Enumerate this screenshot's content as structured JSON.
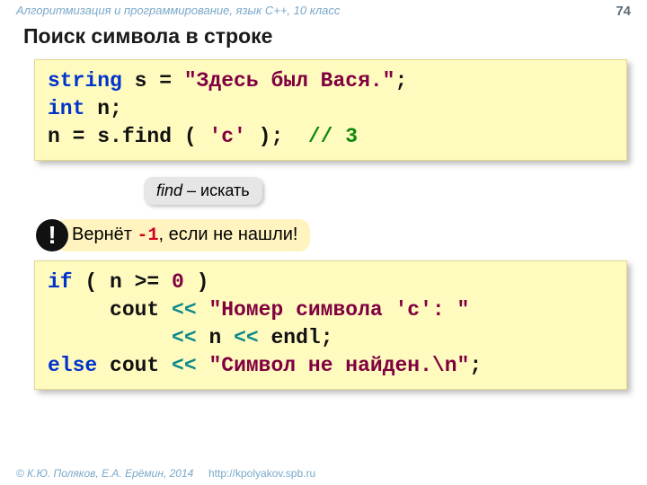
{
  "header": {
    "course": "Алгоритмизация и программирование, язык C++, 10 класс",
    "page": "74"
  },
  "title": "Поиск символа в строке",
  "code1": {
    "l1a": "string",
    "l1b": " s = ",
    "l1c": "\"Здесь был Вася.\"",
    "l1d": ";",
    "l2a": "int",
    "l2b": " n;",
    "l3a": "n = s.find ( ",
    "l3b": "'с'",
    "l3c": " );  ",
    "l3d": "// 3"
  },
  "hint": {
    "word": "find",
    "dash": " – ",
    "ru": "искать"
  },
  "warn": {
    "before": "Вернёт ",
    "val": "-1",
    "after": ", если не нашли!"
  },
  "code2": {
    "l1a": "if",
    "l1b": " ( n >= ",
    "l1c": "0",
    "l1d": " )",
    "l2a": "     cout ",
    "l2b": "<< ",
    "l2c": "\"Номер символа 'c': \"",
    "l3a": "          ",
    "l3b": "<< ",
    "l3c": "n ",
    "l3d": "<< ",
    "l3e": "endl;",
    "l4a": "else",
    "l4b": " cout ",
    "l4c": "<< ",
    "l4d": "\"Символ не найден.\\n\"",
    "l4e": ";"
  },
  "footer": {
    "authors": "© К.Ю. Поляков, Е.А. Ерёмин, 2014",
    "url": "http://kpolyakov.spb.ru"
  }
}
